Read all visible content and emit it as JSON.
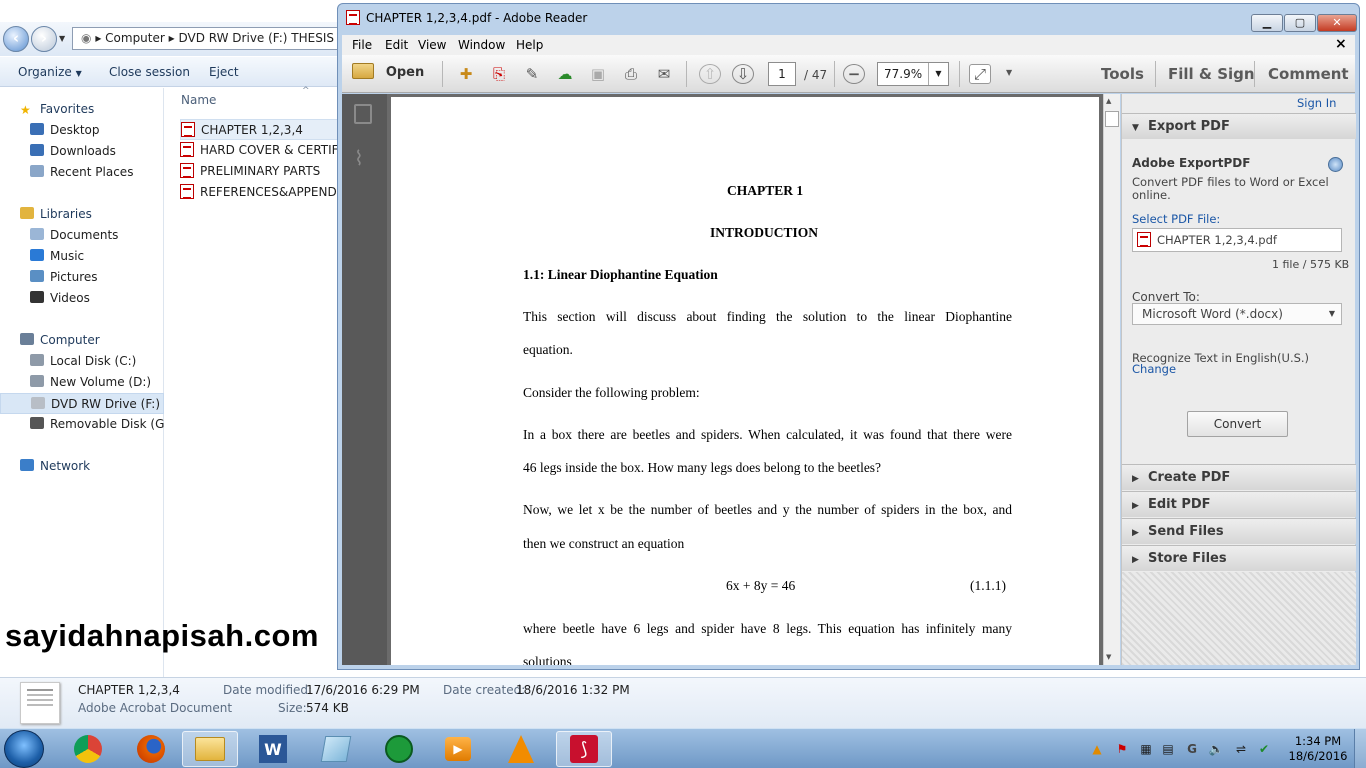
{
  "explorer": {
    "address": [
      "Computer",
      "DVD RW Drive (F:) THESIS SA"
    ],
    "commands": [
      "Organize",
      "Close session",
      "Eject"
    ],
    "nav": [
      {
        "label": "Favorites",
        "type": "group",
        "icon": "star-icon"
      },
      {
        "label": "Desktop",
        "type": "item",
        "icon": "desktop-icon"
      },
      {
        "label": "Downloads",
        "type": "item",
        "icon": "downloads-icon"
      },
      {
        "label": "Recent Places",
        "type": "item",
        "icon": "recent-icon"
      },
      {
        "label": "Libraries",
        "type": "group",
        "icon": "libraries-icon"
      },
      {
        "label": "Documents",
        "type": "item",
        "icon": "documents-icon"
      },
      {
        "label": "Music",
        "type": "item",
        "icon": "music-icon"
      },
      {
        "label": "Pictures",
        "type": "item",
        "icon": "pictures-icon"
      },
      {
        "label": "Videos",
        "type": "item",
        "icon": "videos-icon"
      },
      {
        "label": "Computer",
        "type": "group",
        "icon": "computer-icon"
      },
      {
        "label": "Local Disk (C:)",
        "type": "item",
        "icon": "disk-icon"
      },
      {
        "label": "New Volume (D:)",
        "type": "item",
        "icon": "disk-icon"
      },
      {
        "label": "DVD RW Drive (F:) TH",
        "type": "item",
        "icon": "dvd-icon"
      },
      {
        "label": "Removable Disk (G:)",
        "type": "item",
        "icon": "usb-icon"
      },
      {
        "label": "Network",
        "type": "group",
        "icon": "network-icon"
      }
    ],
    "column_name": "Name",
    "files": [
      "CHAPTER 1,2,3,4",
      "HARD COVER & CERTIFIC",
      "PRELIMINARY PARTS",
      "REFERENCES&APPENDIX"
    ],
    "watermark": "sayidahnapisah.com",
    "details": {
      "name": "CHAPTER 1,2,3,4",
      "type": "Adobe Acrobat Document",
      "modified_label": "Date modified:",
      "modified": "17/6/2016 6:29 PM",
      "created_label": "Date created:",
      "created": "18/6/2016 1:32 PM",
      "size_label": "Size:",
      "size": "574 KB"
    }
  },
  "reader": {
    "title": "CHAPTER 1,2,3,4.pdf - Adobe Reader",
    "menu": [
      "File",
      "Edit",
      "View",
      "Window",
      "Help"
    ],
    "close_x": "×",
    "open_label": "Open",
    "page_current": "1",
    "page_total": "/ 47",
    "zoom": "77.9%",
    "tools_links": [
      "Tools",
      "Fill & Sign",
      "Comment"
    ],
    "document": {
      "chapter": "CHAPTER 1",
      "heading": "INTRODUCTION",
      "section": "1.1: Linear Diophantine Equation",
      "p1a": "This section will discuss about finding the solution to the linear Diophantine",
      "p1b": "equation.",
      "p2": "Consider the following problem:",
      "p3a": "In a box there are beetles and spiders. When calculated, it was found that there were",
      "p3b": "46 legs inside the box. How many legs does belong to the beetles?",
      "p4a": "Now, we let x be the number of beetles and y the number of spiders in the box, and",
      "p4b": "then we construct an equation",
      "equation": "6x + 8y = 46",
      "eq_number": "(1.1.1)",
      "p5a": "where beetle have 6 legs and spider have 8 legs. This equation has infinitely many",
      "p5b": "solutions"
    },
    "panel": {
      "sign_in": "Sign In",
      "export_title": "Export PDF",
      "export_heading": "Adobe ExportPDF",
      "export_desc": "Convert PDF files to Word or Excel online.",
      "select_label": "Select PDF File:",
      "selected_file": "CHAPTER 1,2,3,4.pdf",
      "file_info": "1 file / 575 KB",
      "convert_to_label": "Convert To:",
      "convert_to_value": "Microsoft Word (*.docx)",
      "ocr_text": "Recognize Text in English(U.S.)",
      "change_link": "Change",
      "convert_button": "Convert",
      "sections": [
        "Create PDF",
        "Edit PDF",
        "Send Files",
        "Store Files"
      ]
    }
  },
  "taskbar": {
    "apps": [
      "start-orb",
      "chrome",
      "firefox",
      "explorer",
      "word",
      "notepad",
      "wifi-app",
      "media-player",
      "vlc",
      "acrobat-reader"
    ],
    "time": "1:34 PM",
    "date": "18/6/2016"
  },
  "colors": {
    "taskbar": "#7aa3cf",
    "acrobat_red": "#c8102e",
    "link_blue": "#1a56a6"
  }
}
